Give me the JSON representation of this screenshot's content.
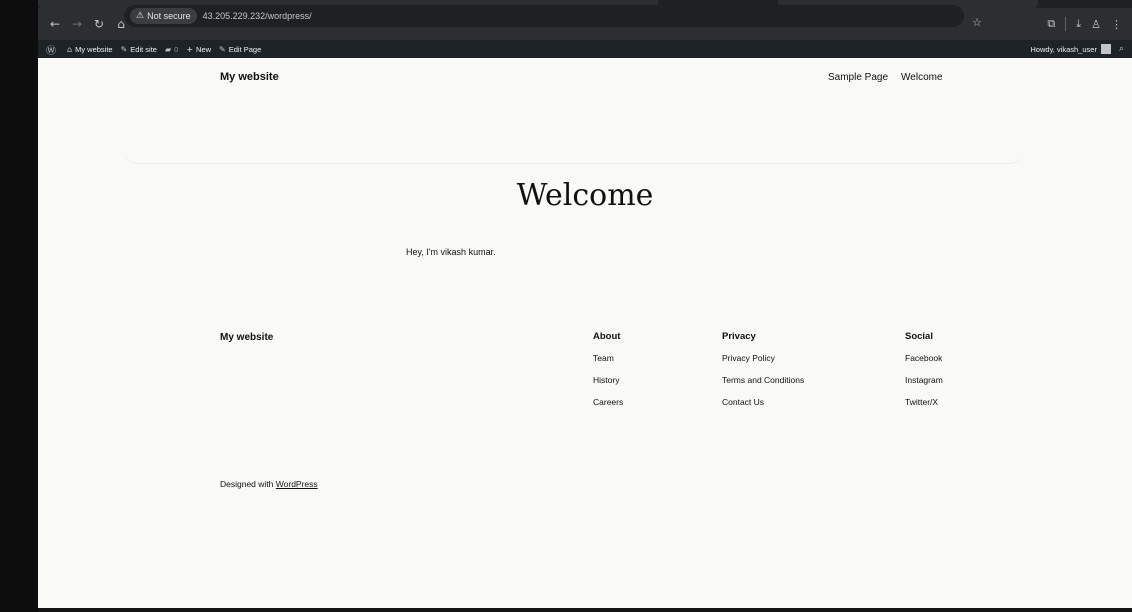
{
  "browser": {
    "security_label": "Not secure",
    "url": "43.205.229.232/wordpress/"
  },
  "admin_bar": {
    "site_name": "My website",
    "edit_site": "Edit site",
    "comments_count": "0",
    "new_label": "New",
    "edit_page": "Edit Page",
    "howdy": "Howdy, vikash_user"
  },
  "header": {
    "site_title": "My website",
    "nav": [
      "Sample Page",
      "Welcome"
    ]
  },
  "content": {
    "title": "Welcome",
    "intro": "Hey, I'm vikash kumar."
  },
  "footer": {
    "site_title": "My website",
    "columns": [
      {
        "heading": "About",
        "links": [
          "Team",
          "History",
          "Careers"
        ]
      },
      {
        "heading": "Privacy",
        "links": [
          "Privacy Policy",
          "Terms and Conditions",
          "Contact Us"
        ]
      },
      {
        "heading": "Social",
        "links": [
          "Facebook",
          "Instagram",
          "Twitter/X"
        ]
      }
    ],
    "credit_prefix": "Designed with ",
    "credit_link": "WordPress"
  }
}
